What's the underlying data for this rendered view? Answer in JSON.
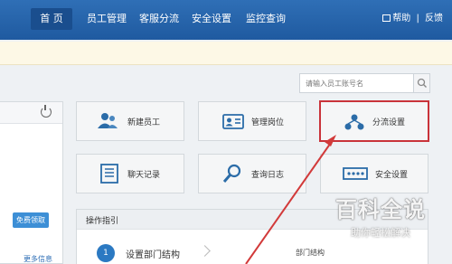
{
  "nav": {
    "items": [
      {
        "label": "首 页"
      },
      {
        "label": "员工管理"
      },
      {
        "label": "客服分流"
      },
      {
        "label": "安全设置"
      },
      {
        "label": "监控查询"
      }
    ],
    "help_label": "帮助",
    "separator": "|",
    "feedback_label": "反馈"
  },
  "search": {
    "placeholder": "请输入员工账号名"
  },
  "left_panel": {
    "free_button": "免费领取",
    "more_link": "更多信息"
  },
  "tiles": [
    {
      "label": "新建员工",
      "icon": "users-icon"
    },
    {
      "label": "管理岗位",
      "icon": "id-card-icon"
    },
    {
      "label": "分流设置",
      "icon": "diversion-icon"
    },
    {
      "label": "聊天记录",
      "icon": "document-icon"
    },
    {
      "label": "查询日志",
      "icon": "magnifier-icon"
    },
    {
      "label": "安全设置",
      "icon": "password-icon"
    }
  ],
  "guide": {
    "title": "操作指引",
    "step_number": "1",
    "step_label": "设置部门结构",
    "detail": "部门结构"
  },
  "watermark": {
    "title": "百科全说",
    "subtitle": "助你轻松解决"
  },
  "colors": {
    "nav_bg": "#2f6fb6",
    "highlight_border": "#c9333a",
    "accent": "#2b79c2"
  }
}
